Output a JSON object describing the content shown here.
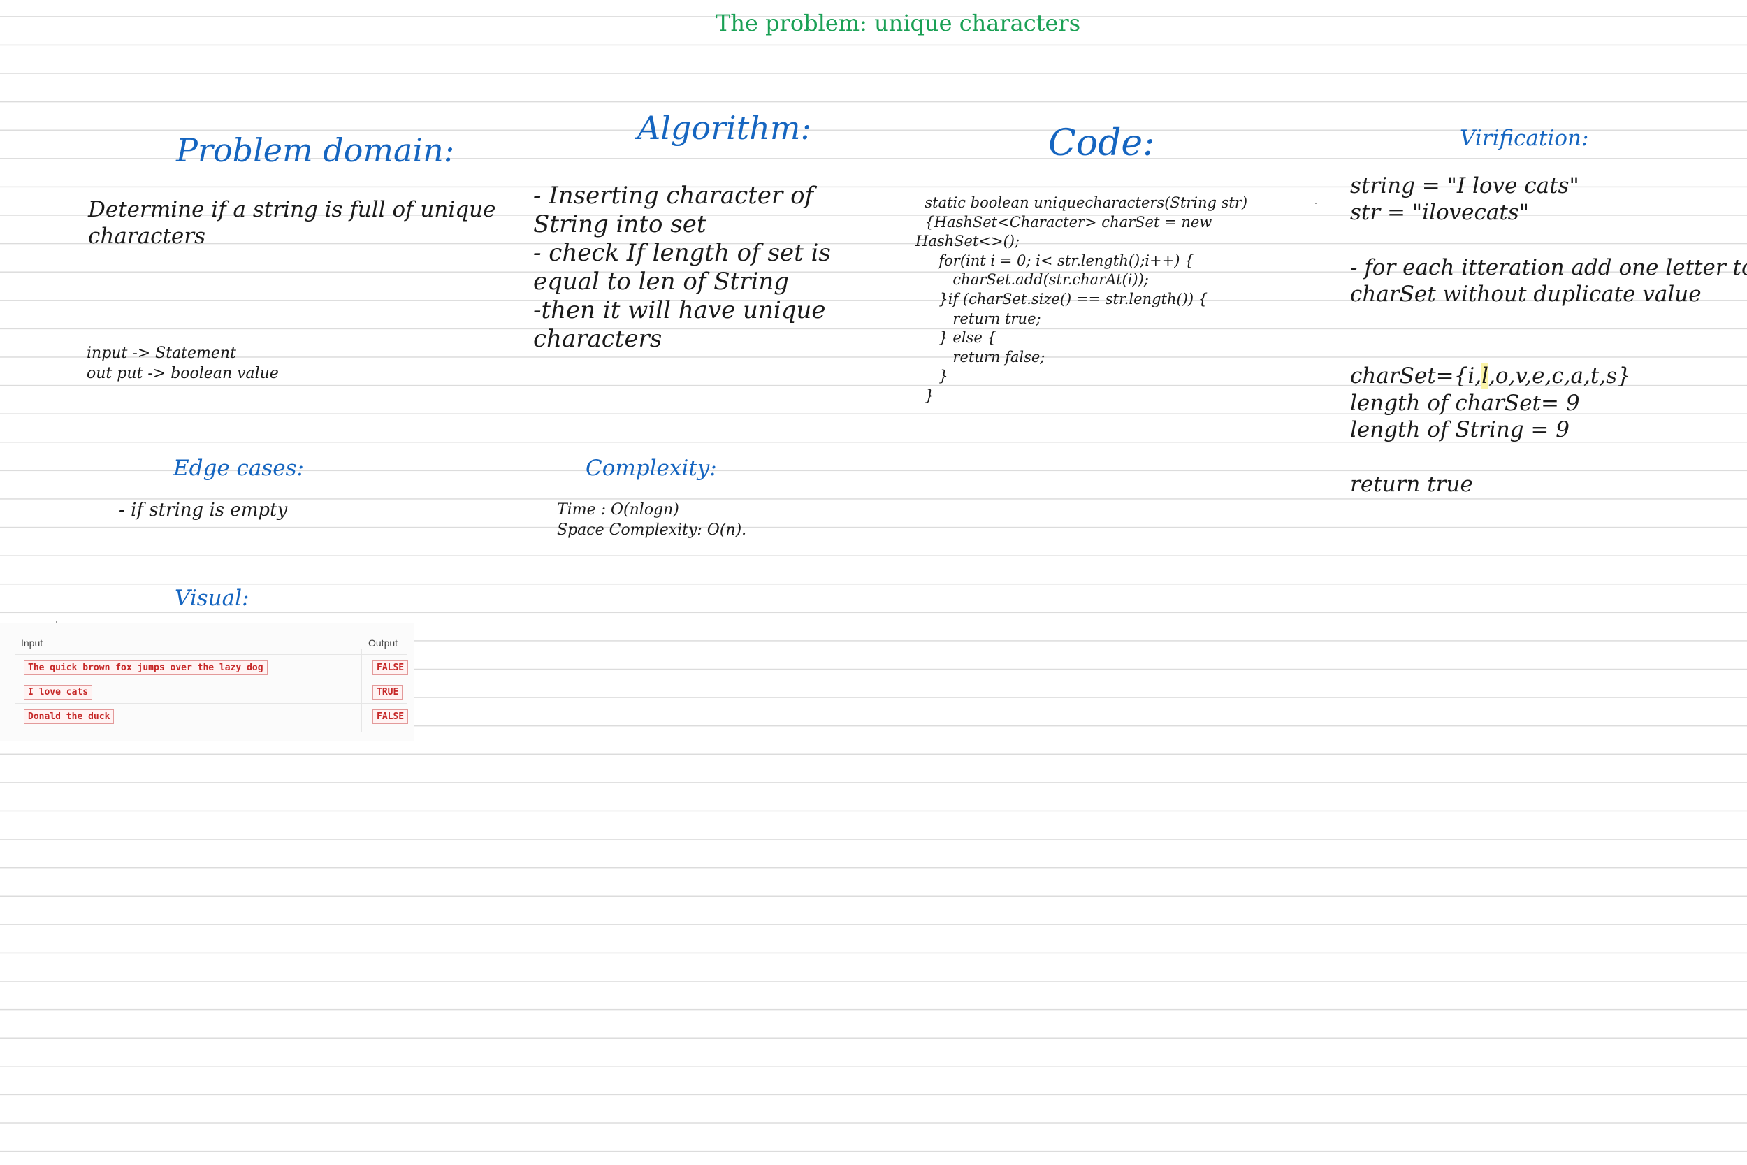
{
  "page_title": "The problem: unique characters",
  "problem_domain": {
    "heading": "Problem domain:",
    "description": "Determine if a string is full of unique\ncharacters",
    "io": "input -> Statement\nout put -> boolean value"
  },
  "algorithm": {
    "heading": "Algorithm:",
    "steps": "- Inserting character of\nString into set\n- check If length of set is\nequal to len of String\n-then it will have unique\ncharacters"
  },
  "code": {
    "heading": "Code:",
    "body": "  static boolean uniquecharacters(String str)\n  {HashSet<Character> charSet = new\nHashSet<>();\n     for(int i = 0; i< str.length();i++) {\n        charSet.add(str.charAt(i));\n     }if (charSet.size() == str.length()) {\n        return true;\n     } else {\n        return false;\n     }\n  }"
  },
  "verification": {
    "heading": "Virification:",
    "strings": "string = \"I love cats\"\nstr = \"ilovecats\"",
    "iteration": "- for each itteration add one letter to\ncharSet without duplicate value",
    "charset_prefix": "charSet={i,",
    "charset_highlight": "l",
    "charset_suffix": ",o,v,e,c,a,t,s}",
    "lengths": "length of charSet= 9\nlength of String = 9",
    "result": "return true"
  },
  "edge_cases": {
    "heading": "Edge cases:",
    "item": "- if string is empty"
  },
  "complexity": {
    "heading": "Complexity:",
    "body": "Time : O(nlogn)\nSpace Complexity: O(n)."
  },
  "visual": {
    "heading": "Visual:",
    "col_input": "Input",
    "col_output": "Output",
    "rows": [
      {
        "input": "The quick brown fox jumps over the lazy dog",
        "output": "FALSE"
      },
      {
        "input": "I love cats",
        "output": "TRUE"
      },
      {
        "input": "Donald the duck",
        "output": "FALSE"
      }
    ]
  }
}
